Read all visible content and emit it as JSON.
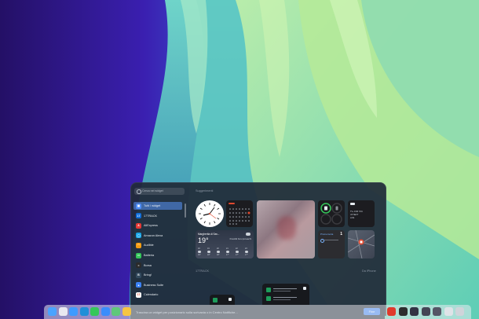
{
  "colors": {
    "accent": "#3b82f6",
    "panel_bg": "#202a38",
    "wall_left": "#2a1473",
    "wall_teal": "#7cd3c0",
    "wall_green": "#a9e38c"
  },
  "gallery": {
    "search": {
      "placeholder": "Cerca nei widget"
    },
    "sidebar": {
      "items": [
        {
          "label": "Tutti i widget",
          "icon": "grid-icon",
          "color": "#4f8ef7",
          "glyph": "▦",
          "selected": true
        },
        {
          "label": "17TRACK",
          "icon": "17track-icon",
          "color": "#0f6dd8",
          "glyph": "17"
        },
        {
          "label": "AliExpress",
          "icon": "aliexpress-icon",
          "color": "#e53935",
          "glyph": "A"
        },
        {
          "label": "Amazon Alexa",
          "icon": "alexa-icon",
          "color": "#19a6e8",
          "glyph": "◯"
        },
        {
          "label": "Audible",
          "icon": "audible-icon",
          "color": "#f39c12",
          "glyph": "◠"
        },
        {
          "label": "Batteria",
          "icon": "battery-icon",
          "color": "#34c759",
          "glyph": "▭"
        },
        {
          "label": "Borsa",
          "icon": "stocks-icon",
          "color": "#2b2b2b",
          "glyph": "≈"
        },
        {
          "label": "Bring!",
          "icon": "bring-icon",
          "color": "#334a5e",
          "glyph": "B"
        },
        {
          "label": "Business Suite",
          "icon": "business-suite-icon",
          "color": "#3b82f6",
          "glyph": "▲"
        },
        {
          "label": "Calendario",
          "icon": "calendar-icon",
          "color": "#ffffff",
          "glyph": "17"
        }
      ]
    },
    "sections": {
      "suggestions": "Suggerimenti",
      "track": "17TRACK",
      "iphone": "Da iPhone"
    },
    "weather": {
      "city": "Margherita di Sav...",
      "temp": "19°",
      "forecast": "Possibili brevi piovaschi",
      "hours": [
        "18",
        "19",
        "20",
        "21",
        "22",
        "23"
      ],
      "temps": [
        "19°",
        "18°",
        "18°",
        "17°",
        "17°",
        "17°"
      ]
    },
    "tv_widget": {
      "line1": "TV+ FOR YOU",
      "line2": "UP NEXT",
      "line3": "LIVE"
    },
    "reminders": {
      "title": "Promemoria",
      "count": "1"
    },
    "drag_hint": "Trascina un widget per posizionarlo sulla scrivania o in Centro Notifiche...",
    "done_label": "Fine"
  },
  "dock": {
    "apps": [
      {
        "name": "finder-icon",
        "color": "#4aa3ff"
      },
      {
        "name": "launchpad-icon",
        "color": "#e8e8f0"
      },
      {
        "name": "safari-icon",
        "color": "#3d9bff"
      },
      {
        "name": "edge-icon",
        "color": "#1f8fd8"
      },
      {
        "name": "messages-icon",
        "color": "#34c759"
      },
      {
        "name": "mail-icon",
        "color": "#3a8dfb"
      },
      {
        "name": "maps-icon",
        "color": "#5fc87a"
      },
      {
        "name": "photos-icon",
        "color": "#f6c542"
      }
    ],
    "right_apps": [
      {
        "name": "app-red-icon",
        "color": "#e03a2c"
      },
      {
        "name": "app-dark-icon",
        "color": "#2d2d2d"
      },
      {
        "name": "window-thumb-1-icon",
        "color": "#334"
      },
      {
        "name": "window-thumb-2-icon",
        "color": "#445"
      },
      {
        "name": "window-thumb-3-icon",
        "color": "#556"
      },
      {
        "name": "window-thumb-4-icon",
        "color": "#dfe3e8"
      },
      {
        "name": "trash-icon",
        "color": "#cfd4da"
      }
    ]
  }
}
